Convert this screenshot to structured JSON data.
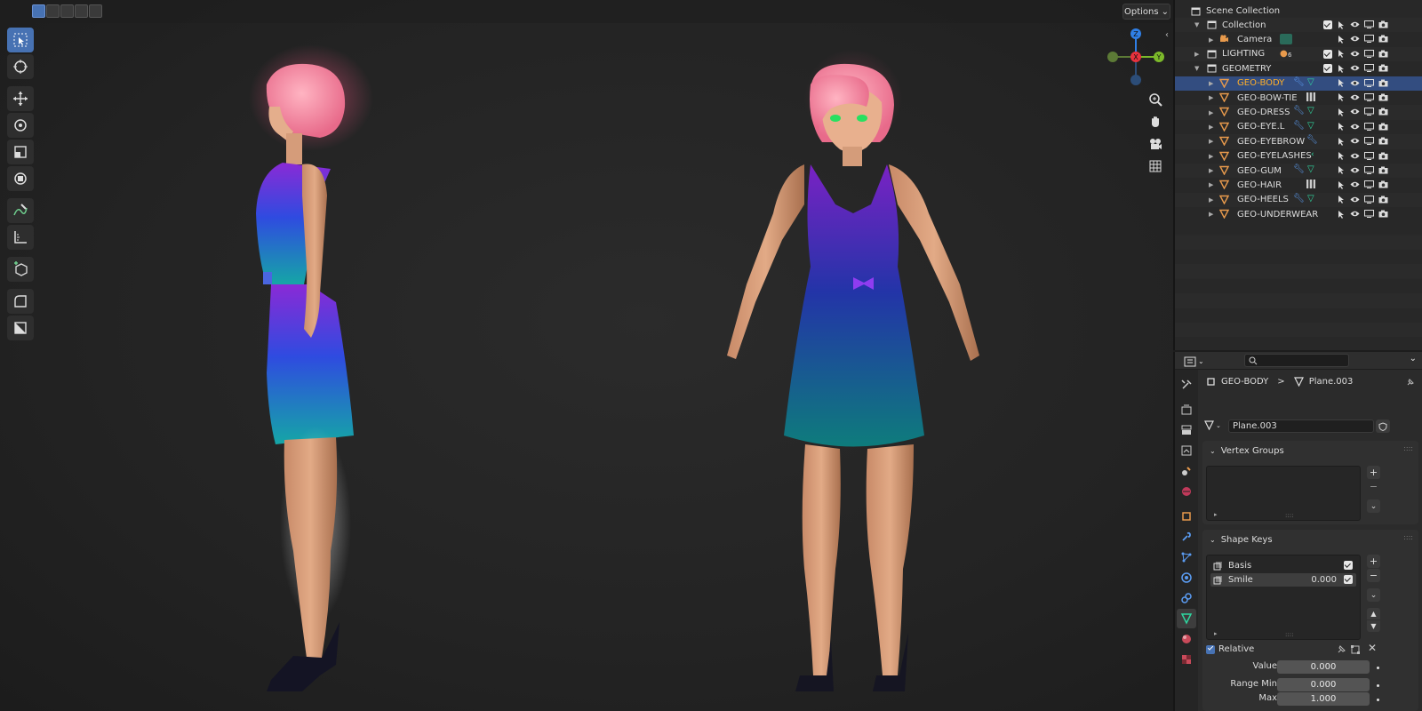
{
  "viewport": {
    "options_label": "Options",
    "tools": [
      "select-box",
      "cursor",
      "move",
      "rotate",
      "scale",
      "transform",
      "annotate",
      "measure",
      "add-cube",
      "shear",
      "to-sphere"
    ]
  },
  "gizmo": {
    "x_label": "X",
    "y_label": "Y",
    "z_label": "Z"
  },
  "outliner": {
    "title": "Scene Collection",
    "rows": [
      {
        "label": "Collection",
        "indent": 1
      },
      {
        "label": "Camera",
        "indent": 2
      },
      {
        "label": "LIGHTING",
        "indent": 1
      },
      {
        "label": "GEOMETRY",
        "indent": 1
      },
      {
        "label": "GEO-BODY",
        "indent": 2
      },
      {
        "label": "GEO-BOW-TIE",
        "indent": 2
      },
      {
        "label": "GEO-DRESS",
        "indent": 2
      },
      {
        "label": "GEO-EYE.L",
        "indent": 2
      },
      {
        "label": "GEO-EYEBROW",
        "indent": 2
      },
      {
        "label": "GEO-EYELASHES",
        "indent": 2
      },
      {
        "label": "GEO-GUM",
        "indent": 2
      },
      {
        "label": "GEO-HAIR",
        "indent": 2
      },
      {
        "label": "GEO-HEELS",
        "indent": 2
      },
      {
        "label": "GEO-UNDERWEAR",
        "indent": 2
      }
    ],
    "lighting_badge": "6"
  },
  "properties": {
    "breadcrumb_object": "GEO-BODY",
    "breadcrumb_sep": ">",
    "breadcrumb_mesh": "Plane.003",
    "mesh_data_name": "Plane.003",
    "vertex_groups_title": "Vertex Groups",
    "shape_keys_title": "Shape Keys",
    "shape_keys": [
      {
        "name": "Basis",
        "value": ""
      },
      {
        "name": "Smile",
        "value": "0.000"
      }
    ],
    "relative_label": "Relative",
    "value_label": "Value",
    "value": "0.000",
    "range_min_label": "Range Min",
    "range_min": "0.000",
    "max_label": "Max",
    "max": "1.000",
    "plus": "+",
    "minus": "−"
  },
  "colors": {
    "accent": "#4772b3",
    "selected_row": "#334d80",
    "selected_text": "#ffaf29",
    "mesh_orange": "#e89a4c",
    "data_green": "#2fd7a0",
    "gizmo_x": "#e8313d",
    "gizmo_y": "#7cb92a",
    "gizmo_z": "#2f7fe6"
  }
}
